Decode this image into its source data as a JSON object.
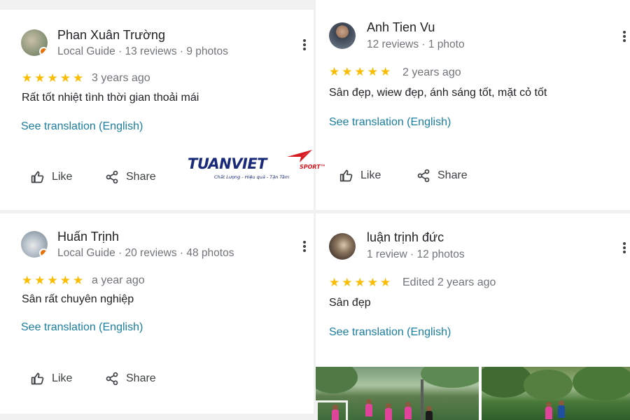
{
  "reviews": [
    {
      "name": "Phan Xuân Trường",
      "meta": "Local Guide · 13 reviews · 9 photos",
      "stars": [
        "★",
        "★",
        "★",
        "★",
        "★"
      ],
      "ago": "3 years ago",
      "text": "Rất tốt nhiệt tình thời gian thoải mái",
      "translate": "See translation (English)",
      "like": "Like",
      "share": "Share",
      "avatar_color": "#9aa58a"
    },
    {
      "name": "Anh Tien Vu",
      "meta": "12 reviews · 1 photo",
      "stars": [
        "★",
        "★",
        "★",
        "★",
        "★"
      ],
      "ago": "2 years ago",
      "text": "Sân đẹp, wiew đẹp, ánh sáng tốt, mặt cỏ tốt",
      "translate": "See translation (English)",
      "like": "Like",
      "share": "Share",
      "avatar_color": "#5f6a78"
    },
    {
      "name": "Huấn Trịnh",
      "meta": "Local Guide · 20 reviews · 48 photos",
      "stars": [
        "★",
        "★",
        "★",
        "★",
        "★"
      ],
      "ago": "a year ago",
      "text": "Sân rất chuyên nghiệp",
      "translate": "See translation (English)",
      "like": "Like",
      "share": "Share",
      "avatar_color": "#b9c2cc"
    },
    {
      "name": "luận trịnh đức",
      "meta": "1 review · 12 photos",
      "stars": [
        "★",
        "★",
        "★",
        "★",
        "★"
      ],
      "ago": "Edited 2 years ago",
      "text": "Sân đẹp",
      "translate": "See translation (English)",
      "avatar_color": "#6e5a4a"
    }
  ],
  "logo": {
    "wordmark": "TUANVIET",
    "sport": "SPORT™",
    "tagline": "Chất Lượng - Hiệu quả - Tận Tâm"
  },
  "colors": {
    "star": "#fbbc04",
    "link": "#1a73e8",
    "secondary_text": "#70757a",
    "local_guide_badge": "#e8710a"
  },
  "icons": [
    "star-icon",
    "more-vert-icon",
    "thumb-up-icon",
    "share-icon",
    "local-guide-badge-icon"
  ]
}
